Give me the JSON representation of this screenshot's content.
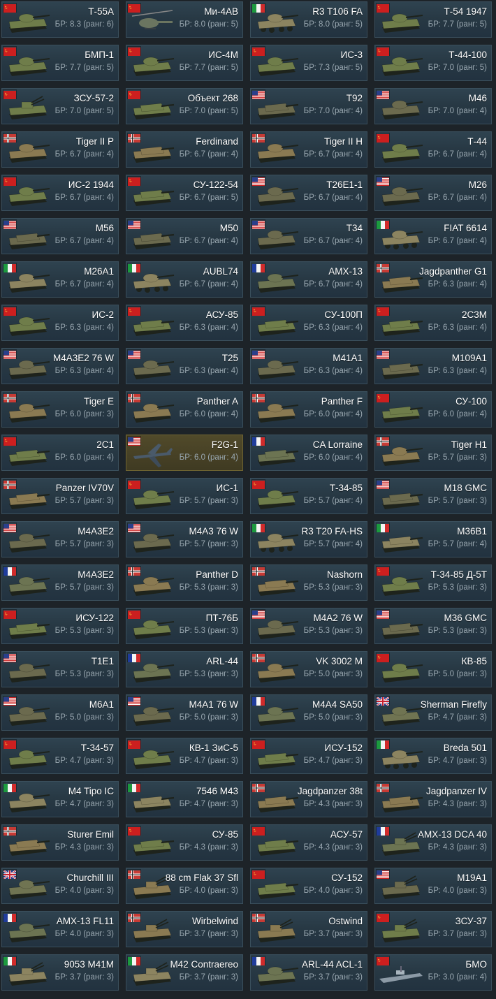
{
  "vehicles": [
    {
      "name": "Т-55А",
      "br": "БР: 8.3 (ранг: 6)",
      "nation": "ussr",
      "kind": "tank"
    },
    {
      "name": "Ми-4АВ",
      "br": "БР: 8.0 (ранг: 5)",
      "nation": "ussr",
      "kind": "heli"
    },
    {
      "name": "R3 T106 FA",
      "br": "БР: 8.0 (ранг: 5)",
      "nation": "italy",
      "kind": "wheeled"
    },
    {
      "name": "Т-54 1947",
      "br": "БР: 7.7 (ранг: 5)",
      "nation": "ussr",
      "kind": "tank"
    },
    {
      "name": "БМП-1",
      "br": "БР: 7.7 (ранг: 5)",
      "nation": "ussr",
      "kind": "ifv"
    },
    {
      "name": "ИС-4М",
      "br": "БР: 7.7 (ранг: 5)",
      "nation": "ussr",
      "kind": "tank"
    },
    {
      "name": "ИС-3",
      "br": "БР: 7.3 (ранг: 5)",
      "nation": "ussr",
      "kind": "tank"
    },
    {
      "name": "Т-44-100",
      "br": "БР: 7.0 (ранг: 5)",
      "nation": "ussr",
      "kind": "tank"
    },
    {
      "name": "ЗСУ-57-2",
      "br": "БР: 7.0 (ранг: 5)",
      "nation": "ussr",
      "kind": "spaa"
    },
    {
      "name": "Объект 268",
      "br": "БР: 7.0 (ранг: 5)",
      "nation": "ussr",
      "kind": "td"
    },
    {
      "name": "T92",
      "br": "БР: 7.0 (ранг: 4)",
      "nation": "usa",
      "kind": "td"
    },
    {
      "name": "M46",
      "br": "БР: 7.0 (ранг: 4)",
      "nation": "usa",
      "kind": "tank"
    },
    {
      "name": "Tiger II P",
      "br": "БР: 6.7 (ранг: 4)",
      "nation": "germany",
      "kind": "tank"
    },
    {
      "name": "Ferdinand",
      "br": "БР: 6.7 (ранг: 4)",
      "nation": "germany",
      "kind": "td"
    },
    {
      "name": "Tiger II H",
      "br": "БР: 6.7 (ранг: 4)",
      "nation": "germany",
      "kind": "tank"
    },
    {
      "name": "Т-44",
      "br": "БР: 6.7 (ранг: 4)",
      "nation": "ussr",
      "kind": "tank"
    },
    {
      "name": "ИС-2 1944",
      "br": "БР: 6.7 (ранг: 4)",
      "nation": "ussr",
      "kind": "tank"
    },
    {
      "name": "СУ-122-54",
      "br": "БР: 6.7 (ранг: 5)",
      "nation": "ussr",
      "kind": "td"
    },
    {
      "name": "T26E1-1",
      "br": "БР: 6.7 (ранг: 4)",
      "nation": "usa",
      "kind": "tank"
    },
    {
      "name": "M26",
      "br": "БР: 6.7 (ранг: 4)",
      "nation": "usa",
      "kind": "tank"
    },
    {
      "name": "M56",
      "br": "БР: 6.7 (ранг: 4)",
      "nation": "usa",
      "kind": "td"
    },
    {
      "name": "M50",
      "br": "БР: 6.7 (ранг: 4)",
      "nation": "usa",
      "kind": "td"
    },
    {
      "name": "T34",
      "br": "БР: 6.7 (ранг: 4)",
      "nation": "usa",
      "kind": "tank"
    },
    {
      "name": "FIAT 6614",
      "br": "БР: 6.7 (ранг: 4)",
      "nation": "italy",
      "kind": "wheeled"
    },
    {
      "name": "M26A1",
      "br": "БР: 6.7 (ранг: 4)",
      "nation": "italy",
      "kind": "tank"
    },
    {
      "name": "AUBL74",
      "br": "БР: 6.7 (ранг: 4)",
      "nation": "italy",
      "kind": "wheeled"
    },
    {
      "name": "AMX-13",
      "br": "БР: 6.7 (ранг: 4)",
      "nation": "france",
      "kind": "tank"
    },
    {
      "name": "Jagdpanther G1",
      "br": "БР: 6.3 (ранг: 4)",
      "nation": "germany",
      "kind": "td"
    },
    {
      "name": "ИС-2",
      "br": "БР: 6.3 (ранг: 4)",
      "nation": "ussr",
      "kind": "tank"
    },
    {
      "name": "АСУ-85",
      "br": "БР: 6.3 (ранг: 4)",
      "nation": "ussr",
      "kind": "td"
    },
    {
      "name": "СУ-100П",
      "br": "БР: 6.3 (ранг: 4)",
      "nation": "ussr",
      "kind": "td"
    },
    {
      "name": "2С3М",
      "br": "БР: 6.3 (ранг: 4)",
      "nation": "ussr",
      "kind": "td"
    },
    {
      "name": "M4A3E2 76 W",
      "br": "БР: 6.3 (ранг: 4)",
      "nation": "usa",
      "kind": "tank"
    },
    {
      "name": "T25",
      "br": "БР: 6.3 (ранг: 4)",
      "nation": "usa",
      "kind": "tank"
    },
    {
      "name": "M41A1",
      "br": "БР: 6.3 (ранг: 4)",
      "nation": "usa",
      "kind": "tank"
    },
    {
      "name": "M109A1",
      "br": "БР: 6.3 (ранг: 4)",
      "nation": "usa",
      "kind": "td"
    },
    {
      "name": "Tiger E",
      "br": "БР: 6.0 (ранг: 3)",
      "nation": "germany",
      "kind": "tank"
    },
    {
      "name": "Panther A",
      "br": "БР: 6.0 (ранг: 4)",
      "nation": "germany",
      "kind": "tank"
    },
    {
      "name": "Panther F",
      "br": "БР: 6.0 (ранг: 4)",
      "nation": "germany",
      "kind": "tank"
    },
    {
      "name": "СУ-100",
      "br": "БР: 6.0 (ранг: 4)",
      "nation": "ussr",
      "kind": "td"
    },
    {
      "name": "2С1",
      "br": "БР: 6.0 (ранг: 4)",
      "nation": "ussr",
      "kind": "td"
    },
    {
      "name": "F2G-1",
      "br": "БР: 6.0 (ранг: 4)",
      "nation": "usa",
      "kind": "plane",
      "premium": true
    },
    {
      "name": "CA Lorraine",
      "br": "БР: 6.0 (ранг: 4)",
      "nation": "france",
      "kind": "td"
    },
    {
      "name": "Tiger H1",
      "br": "БР: 5.7 (ранг: 3)",
      "nation": "germany",
      "kind": "tank"
    },
    {
      "name": "Panzer IV70V",
      "br": "БР: 5.7 (ранг: 3)",
      "nation": "germany",
      "kind": "td"
    },
    {
      "name": "ИС-1",
      "br": "БР: 5.7 (ранг: 3)",
      "nation": "ussr",
      "kind": "tank"
    },
    {
      "name": "Т-34-85",
      "br": "БР: 5.7 (ранг: 4)",
      "nation": "ussr",
      "kind": "tank"
    },
    {
      "name": "M18 GMC",
      "br": "БР: 5.7 (ранг: 3)",
      "nation": "usa",
      "kind": "td"
    },
    {
      "name": "M4A3E2",
      "br": "БР: 5.7 (ранг: 3)",
      "nation": "usa",
      "kind": "tank"
    },
    {
      "name": "M4A3 76 W",
      "br": "БР: 5.7 (ранг: 3)",
      "nation": "usa",
      "kind": "tank"
    },
    {
      "name": "R3 T20 FA-HS",
      "br": "БР: 5.7 (ранг: 4)",
      "nation": "italy",
      "kind": "wheeled"
    },
    {
      "name": "M36B1",
      "br": "БР: 5.7 (ранг: 4)",
      "nation": "italy",
      "kind": "td"
    },
    {
      "name": "M4A3E2",
      "br": "БР: 5.7 (ранг: 3)",
      "nation": "france",
      "kind": "tank"
    },
    {
      "name": "Panther D",
      "br": "БР: 5.3 (ранг: 3)",
      "nation": "germany",
      "kind": "tank"
    },
    {
      "name": "Nashorn",
      "br": "БР: 5.3 (ранг: 3)",
      "nation": "germany",
      "kind": "td"
    },
    {
      "name": "Т-34-85 Д-5Т",
      "br": "БР: 5.3 (ранг: 3)",
      "nation": "ussr",
      "kind": "tank"
    },
    {
      "name": "ИСУ-122",
      "br": "БР: 5.3 (ранг: 3)",
      "nation": "ussr",
      "kind": "td"
    },
    {
      "name": "ПТ-76Б",
      "br": "БР: 5.3 (ранг: 3)",
      "nation": "ussr",
      "kind": "tank"
    },
    {
      "name": "M4A2 76 W",
      "br": "БР: 5.3 (ранг: 3)",
      "nation": "usa",
      "kind": "tank"
    },
    {
      "name": "M36 GMC",
      "br": "БР: 5.3 (ранг: 3)",
      "nation": "usa",
      "kind": "td"
    },
    {
      "name": "T1E1",
      "br": "БР: 5.3 (ранг: 3)",
      "nation": "usa",
      "kind": "tank"
    },
    {
      "name": "ARL-44",
      "br": "БР: 5.3 (ранг: 3)",
      "nation": "france",
      "kind": "tank"
    },
    {
      "name": "VK 3002 M",
      "br": "БР: 5.0 (ранг: 3)",
      "nation": "germany",
      "kind": "tank"
    },
    {
      "name": "КВ-85",
      "br": "БР: 5.0 (ранг: 3)",
      "nation": "ussr",
      "kind": "tank"
    },
    {
      "name": "M6A1",
      "br": "БР: 5.0 (ранг: 3)",
      "nation": "usa",
      "kind": "tank"
    },
    {
      "name": "M4A1 76 W",
      "br": "БР: 5.0 (ранг: 3)",
      "nation": "usa",
      "kind": "tank"
    },
    {
      "name": "M4A4 SA50",
      "br": "БР: 5.0 (ранг: 3)",
      "nation": "france",
      "kind": "tank"
    },
    {
      "name": "Sherman Firefly",
      "br": "БР: 4.7 (ранг: 3)",
      "nation": "uk",
      "kind": "tank"
    },
    {
      "name": "Т-34-57",
      "br": "БР: 4.7 (ранг: 3)",
      "nation": "ussr",
      "kind": "tank"
    },
    {
      "name": "КВ-1 ЗиС-5",
      "br": "БР: 4.7 (ранг: 3)",
      "nation": "ussr",
      "kind": "tank"
    },
    {
      "name": "ИСУ-152",
      "br": "БР: 4.7 (ранг: 3)",
      "nation": "ussr",
      "kind": "td"
    },
    {
      "name": "Breda 501",
      "br": "БР: 4.7 (ранг: 3)",
      "nation": "italy",
      "kind": "wheeled"
    },
    {
      "name": "M4 Tipo IC",
      "br": "БР: 4.7 (ранг: 3)",
      "nation": "italy",
      "kind": "tank"
    },
    {
      "name": "7546 M43",
      "br": "БР: 4.7 (ранг: 3)",
      "nation": "italy",
      "kind": "td"
    },
    {
      "name": "Jagdpanzer 38t",
      "br": "БР: 4.3 (ранг: 3)",
      "nation": "germany",
      "kind": "td"
    },
    {
      "name": "Jagdpanzer IV",
      "br": "БР: 4.3 (ранг: 3)",
      "nation": "germany",
      "kind": "td"
    },
    {
      "name": "Sturer Emil",
      "br": "БР: 4.3 (ранг: 3)",
      "nation": "germany",
      "kind": "td"
    },
    {
      "name": "СУ-85",
      "br": "БР: 4.3 (ранг: 3)",
      "nation": "ussr",
      "kind": "td"
    },
    {
      "name": "АСУ-57",
      "br": "БР: 4.3 (ранг: 3)",
      "nation": "ussr",
      "kind": "td"
    },
    {
      "name": "AMX-13 DCA 40",
      "br": "БР: 4.3 (ранг: 3)",
      "nation": "france",
      "kind": "spaa"
    },
    {
      "name": "Churchill III",
      "br": "БР: 4.0 (ранг: 3)",
      "nation": "uk",
      "kind": "tank"
    },
    {
      "name": "88 cm Flak 37 Sfl",
      "br": "БР: 4.0 (ранг: 3)",
      "nation": "germany",
      "kind": "spaa"
    },
    {
      "name": "СУ-152",
      "br": "БР: 4.0 (ранг: 3)",
      "nation": "ussr",
      "kind": "td"
    },
    {
      "name": "M19A1",
      "br": "БР: 4.0 (ранг: 3)",
      "nation": "usa",
      "kind": "spaa"
    },
    {
      "name": "AMX-13 FL11",
      "br": "БР: 4.0 (ранг: 3)",
      "nation": "france",
      "kind": "tank"
    },
    {
      "name": "Wirbelwind",
      "br": "БР: 3.7 (ранг: 3)",
      "nation": "germany",
      "kind": "spaa"
    },
    {
      "name": "Ostwind",
      "br": "БР: 3.7 (ранг: 3)",
      "nation": "germany",
      "kind": "spaa"
    },
    {
      "name": "ЗСУ-37",
      "br": "БР: 3.7 (ранг: 3)",
      "nation": "ussr",
      "kind": "spaa"
    },
    {
      "name": "9053 M41M",
      "br": "БР: 3.7 (ранг: 3)",
      "nation": "italy",
      "kind": "spaa"
    },
    {
      "name": "M42 Contraereo",
      "br": "БР: 3.7 (ранг: 3)",
      "nation": "italy",
      "kind": "spaa"
    },
    {
      "name": "ARL-44 ACL-1",
      "br": "БР: 3.7 (ранг: 3)",
      "nation": "france",
      "kind": "tank"
    },
    {
      "name": "БМО",
      "br": "БР: 3.0 (ранг: 4)",
      "nation": "ussr",
      "kind": "boat"
    }
  ],
  "flag_icons": {
    "ussr": "ussr-flag-icon",
    "usa": "usa-flag-icon",
    "germany": "germany-flag-icon",
    "italy": "italy-flag-icon",
    "france": "france-flag-icon",
    "uk": "uk-flag-icon"
  },
  "vehicle_icons": {
    "tank": "tank-icon",
    "td": "tank-destroyer-icon",
    "spaa": "anti-aircraft-vehicle-icon",
    "wheeled": "wheeled-vehicle-icon",
    "ifv": "ifv-icon",
    "heli": "helicopter-icon",
    "plane": "airplane-icon",
    "boat": "boat-icon"
  },
  "colors": {
    "card_bg": "#273844",
    "premium_bg": "#4a4326",
    "name_text": "#ffffff",
    "br_text": "#9aa8b1",
    "page_bg": "#1d2328"
  }
}
